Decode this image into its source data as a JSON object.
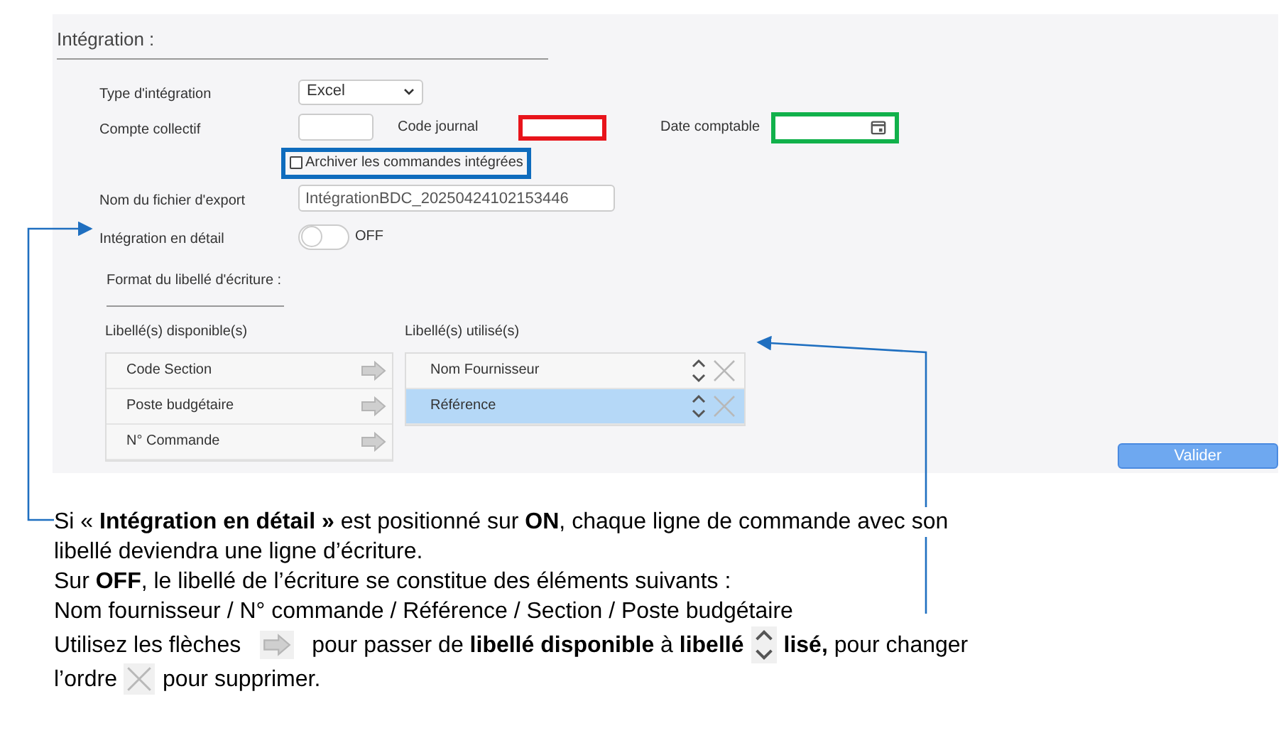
{
  "panel": {
    "title": "Intégration :",
    "type_integration": {
      "label": "Type d'intégration",
      "value": "Excel"
    },
    "compte_collectif": {
      "label": "Compte collectif"
    },
    "code_journal": {
      "label": "Code journal"
    },
    "date_comptable": {
      "label": "Date comptable"
    },
    "archiver": {
      "label": "Archiver les commandes intégrées",
      "checked": false
    },
    "export_file": {
      "label": "Nom du fichier d'export",
      "value": "IntégrationBDC_20250424102153446"
    },
    "detail": {
      "label": "Intégration en détail",
      "on": false,
      "state_text": "OFF"
    },
    "format_title": "Format du libellé d'écriture :",
    "available": {
      "title": "Libellé(s) disponible(s)",
      "items": [
        {
          "label": "Code Section"
        },
        {
          "label": "Poste budgétaire"
        },
        {
          "label": "N° Commande"
        }
      ]
    },
    "used": {
      "title": "Libellé(s) utilisé(s)",
      "items": [
        {
          "label": "Nom Fournisseur",
          "selected": false
        },
        {
          "label": "Référence",
          "selected": true
        }
      ]
    },
    "submit": "Valider"
  },
  "note": [
    [
      {
        "kind": "text",
        "text": "Si « **Intégration en détail »** est positionné sur **ON**, chaque ligne de commande avec son"
      }
    ],
    [
      {
        "kind": "text",
        "text": "libellé deviendra une ligne d’écriture."
      }
    ],
    [
      {
        "kind": "text",
        "text": "Sur **OFF**, le libellé de l’écriture se constitue des éléments suivants :"
      }
    ],
    [
      {
        "kind": "text",
        "text": "Nom fournisseur / N° commande / Référence / Section / Poste budgétaire"
      }
    ],
    [
      {
        "kind": "text",
        "text": "Utilisez les flèches"
      },
      {
        "kind": "arrow"
      },
      {
        "kind": "text",
        "text": "pour passer de **libellé disponible** à **libellé**"
      },
      {
        "kind": "updown"
      },
      {
        "kind": "text",
        "text": "**lisé,** pour changer"
      }
    ],
    [
      {
        "kind": "text",
        "text": "l’ordre"
      },
      {
        "kind": "cross"
      },
      {
        "kind": "text",
        "text": "pour supprimer."
      }
    ]
  ]
}
